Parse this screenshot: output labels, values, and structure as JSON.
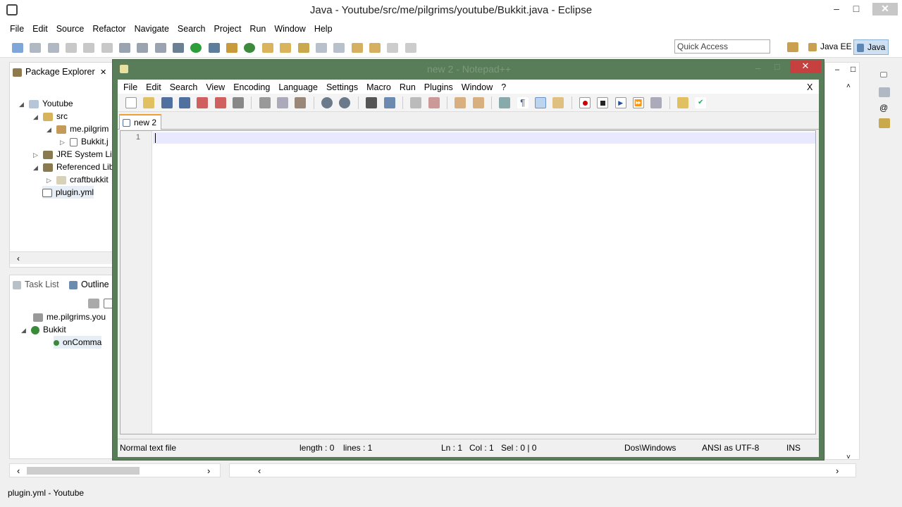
{
  "window": {
    "title": "Java - Youtube/src/me/pilgrims/youtube/Bukkit.java - Eclipse"
  },
  "menu": [
    "File",
    "Edit",
    "Source",
    "Refactor",
    "Navigate",
    "Search",
    "Project",
    "Run",
    "Window",
    "Help"
  ],
  "toolbar": {
    "quick_access_placeholder": "Quick Access",
    "perspective_javaee": "Java EE",
    "perspective_java": "Java"
  },
  "package_explorer": {
    "title": "Package Explorer",
    "items": [
      {
        "label": "Youtube"
      },
      {
        "label": "src"
      },
      {
        "label": "me.pilgrim"
      },
      {
        "label": "Bukkit.j"
      },
      {
        "label": "JRE System Lib"
      },
      {
        "label": "Referenced Lib"
      },
      {
        "label": "craftbukkit"
      },
      {
        "label": "plugin.yml"
      }
    ]
  },
  "lower_panel": {
    "tab_tasks": "Task List",
    "tab_outline": "Outline",
    "items": [
      {
        "label": "me.pilgrims.you"
      },
      {
        "label": "Bukkit"
      },
      {
        "label": "onComma"
      }
    ]
  },
  "statusline": "plugin.yml - Youtube",
  "notepad": {
    "title": "new  2 - Notepad++",
    "menu": [
      "File",
      "Edit",
      "Search",
      "View",
      "Encoding",
      "Language",
      "Settings",
      "Macro",
      "Run",
      "Plugins",
      "Window",
      "?"
    ],
    "close_x": "X",
    "tab": "new 2",
    "line_number": "1",
    "status": {
      "type": "Normal text file",
      "length": "length : 0",
      "lines": "lines : 1",
      "ln": "Ln : 1",
      "col": "Col : 1",
      "sel": "Sel : 0 | 0",
      "eol": "Dos\\Windows",
      "encoding": "ANSI as UTF-8",
      "mode": "INS"
    }
  }
}
